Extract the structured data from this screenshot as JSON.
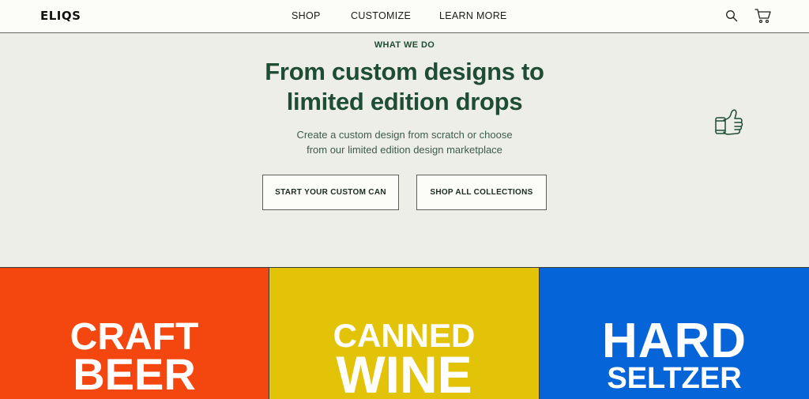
{
  "nav": {
    "logo": "ELIQS",
    "links": [
      "SHOP",
      "CUSTOMIZE",
      "LEARN MORE"
    ],
    "icons": [
      "search-icon",
      "cart-icon"
    ]
  },
  "hero": {
    "eyebrow": "WHAT WE DO",
    "headline_line1": "From custom designs to",
    "headline_line2": "limited edition drops",
    "subtext_line1": "Create a custom design from scratch or choose",
    "subtext_line2": "from our limited edition design marketplace",
    "buttons": [
      "START YOUR CUSTOM CAN",
      "SHOP ALL COLLECTIONS"
    ],
    "decoration_icon": "thumbs-up-can-icon"
  },
  "categories": [
    {
      "line1": "CRAFT",
      "line2": "BEER",
      "color": "#f4470f"
    },
    {
      "line1": "CANNED",
      "line2": "WINE",
      "color": "#e2c308"
    },
    {
      "line1": "HARD",
      "line2": "SELTZER",
      "color": "#0565d8"
    }
  ],
  "colors": {
    "brand_green": "#1e4d33",
    "hero_bg": "#eeeee8",
    "nav_bg": "#fcfcf8"
  }
}
